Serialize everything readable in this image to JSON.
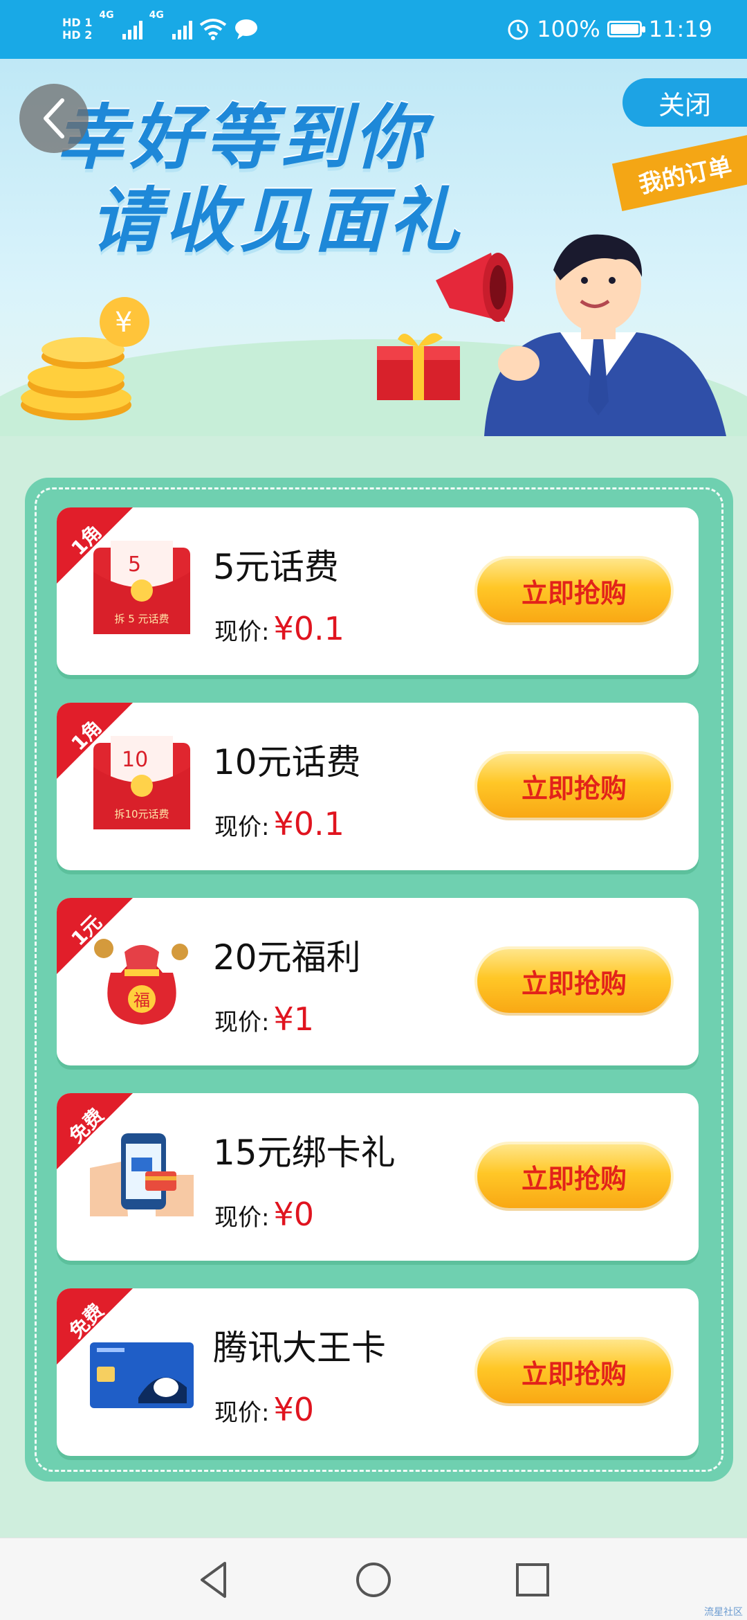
{
  "status_bar": {
    "hd1": "HD 1",
    "hd2": "HD 2",
    "network1": "4G",
    "network2": "4G",
    "battery": "100%",
    "time": "11:19"
  },
  "banner": {
    "headline_line1": "幸好等到你",
    "headline_line2": "请收见面礼",
    "close_label": "关闭",
    "my_orders_label": "我的订单"
  },
  "products": [
    {
      "ribbon": "1角",
      "title": "5元话费",
      "price_label": "现价:",
      "price": "¥0.1",
      "button": "立即抢购",
      "icon": "red-envelope-icon",
      "thumb_text": "5",
      "thumb_sub": "拆 5 元话费"
    },
    {
      "ribbon": "1角",
      "title": "10元话费",
      "price_label": "现价:",
      "price": "¥0.1",
      "button": "立即抢购",
      "icon": "red-envelope-icon",
      "thumb_text": "10",
      "thumb_sub": "拆10元话费"
    },
    {
      "ribbon": "1元",
      "title": "20元福利",
      "price_label": "现价:",
      "price": "¥1",
      "button": "立即抢购",
      "icon": "lucky-bag-icon",
      "thumb_text": "福",
      "thumb_sub": ""
    },
    {
      "ribbon": "免费",
      "title": "15元绑卡礼",
      "price_label": "现价:",
      "price": "¥0",
      "button": "立即抢购",
      "icon": "phone-payment-icon",
      "thumb_text": "",
      "thumb_sub": ""
    },
    {
      "ribbon": "免费",
      "title": "腾讯大王卡",
      "price_label": "现价:",
      "price": "¥0",
      "button": "立即抢购",
      "icon": "sim-card-icon",
      "thumb_text": "",
      "thumb_sub": ""
    }
  ],
  "watermark": "流星社区",
  "colors": {
    "status_bar": "#19a9e6",
    "panel": "#6fd0b0",
    "price": "#e0141f",
    "ribbon": "#e11e2a",
    "button": "#ffc727"
  }
}
